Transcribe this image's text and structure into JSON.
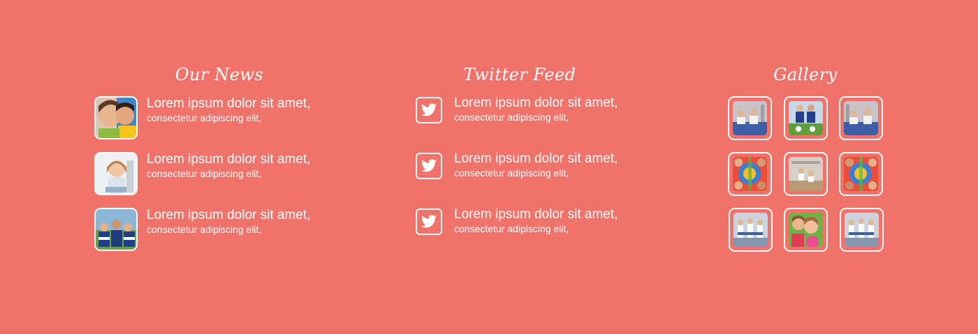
{
  "colors": {
    "background": "#f0736b",
    "text": "#ffffff"
  },
  "news": {
    "title": "Our News",
    "items": [
      {
        "title": "Lorem ipsum dolor sit amet,",
        "subtitle": "consectetur adipiscing elit,",
        "image": "kids-faces-photo"
      },
      {
        "title": "Lorem ipsum dolor sit amet,",
        "subtitle": "consectetur adipiscing elit,",
        "image": "girl-drawing-photo"
      },
      {
        "title": "Lorem ipsum dolor sit amet,",
        "subtitle": "consectetur adipiscing elit,",
        "image": "soccer-team-photo"
      }
    ]
  },
  "twitter": {
    "title": "Twitter Feed",
    "icon": "twitter-bird-icon",
    "items": [
      {
        "title": "Lorem ipsum dolor sit amet,",
        "subtitle": "consectetur adipiscing elit,"
      },
      {
        "title": "Lorem ipsum dolor sit amet,",
        "subtitle": "consectetur adipiscing elit,"
      },
      {
        "title": "Lorem ipsum dolor sit amet,",
        "subtitle": "consectetur adipiscing elit,"
      }
    ]
  },
  "gallery": {
    "title": "Gallery",
    "images": [
      "yoga-class-photo",
      "soccer-kids-photo",
      "yoga-class-photo",
      "kids-circle-photo",
      "gym-class-photo",
      "kids-circle-photo",
      "dance-class-photo",
      "girls-smiling-photo",
      "dance-class-photo"
    ]
  }
}
